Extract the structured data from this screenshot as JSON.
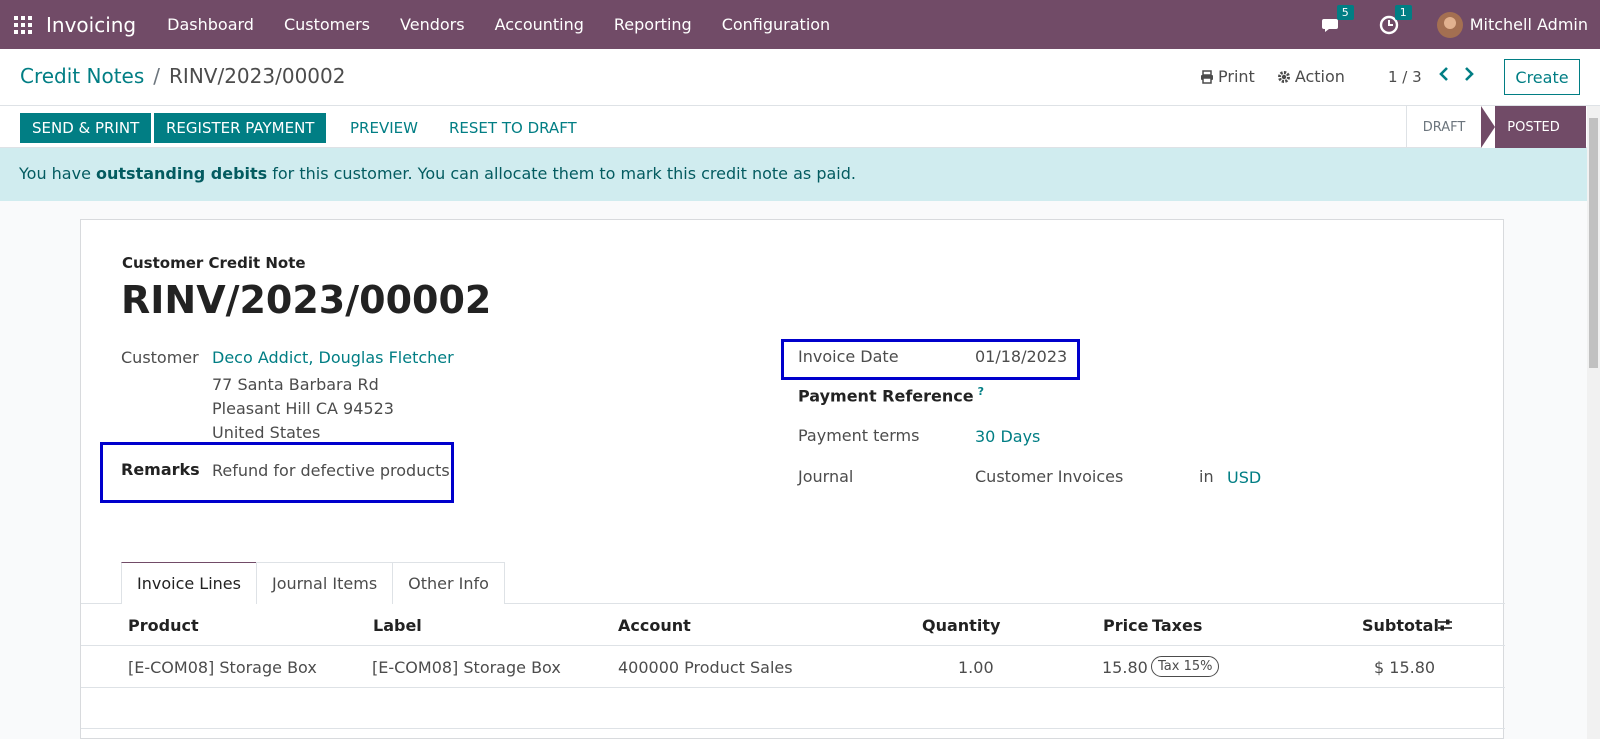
{
  "navbar": {
    "brand": "Invoicing",
    "menu": [
      "Dashboard",
      "Customers",
      "Vendors",
      "Accounting",
      "Reporting",
      "Configuration"
    ],
    "messages_count": "5",
    "activities_count": "1",
    "user": "Mitchell Admin"
  },
  "control_panel": {
    "breadcrumb_parent": "Credit Notes",
    "breadcrumb_current": "RINV/2023/00002",
    "print_label": "Print",
    "action_label": "Action",
    "pager": "1 / 3",
    "create_label": "Create"
  },
  "statusbar": {
    "buttons": [
      "Send & Print",
      "Register Payment",
      "Preview",
      "Reset to Draft"
    ],
    "stages": [
      "Draft",
      "Posted"
    ],
    "active_stage": "Posted"
  },
  "alert": {
    "prefix": "You have ",
    "bold": "outstanding debits",
    "suffix": " for this customer. You can allocate them to mark this credit note as paid."
  },
  "document": {
    "type": "Customer Credit Note",
    "number": "RINV/2023/00002",
    "customer_label": "Customer",
    "customer_name": "Deco Addict, Douglas Fletcher",
    "address_line1": "77 Santa Barbara Rd",
    "address_line2": "Pleasant Hill CA 94523",
    "address_line3": "United States",
    "remarks_label": "Remarks",
    "remarks_value": "Refund for defective products",
    "invoice_date_label": "Invoice Date",
    "invoice_date_value": "01/18/2023",
    "payment_reference_label": "Payment Reference",
    "payment_reference_help": "?",
    "payment_terms_label": "Payment terms",
    "payment_terms_value": "30 Days",
    "journal_label": "Journal",
    "journal_value": "Customer Invoices",
    "journal_in": "in",
    "currency": "USD"
  },
  "tabs": [
    "Invoice Lines",
    "Journal Items",
    "Other Info"
  ],
  "lines": {
    "headers": {
      "product": "Product",
      "label": "Label",
      "account": "Account",
      "quantity": "Quantity",
      "price": "Price",
      "taxes": "Taxes",
      "subtotal": "Subtotal"
    },
    "rows": [
      {
        "product": "[E-COM08] Storage Box",
        "label": "[E-COM08] Storage Box",
        "account": "400000 Product Sales",
        "quantity": "1.00",
        "price": "15.80",
        "tax": "Tax 15%",
        "subtotal": "$ 15.80"
      }
    ]
  }
}
